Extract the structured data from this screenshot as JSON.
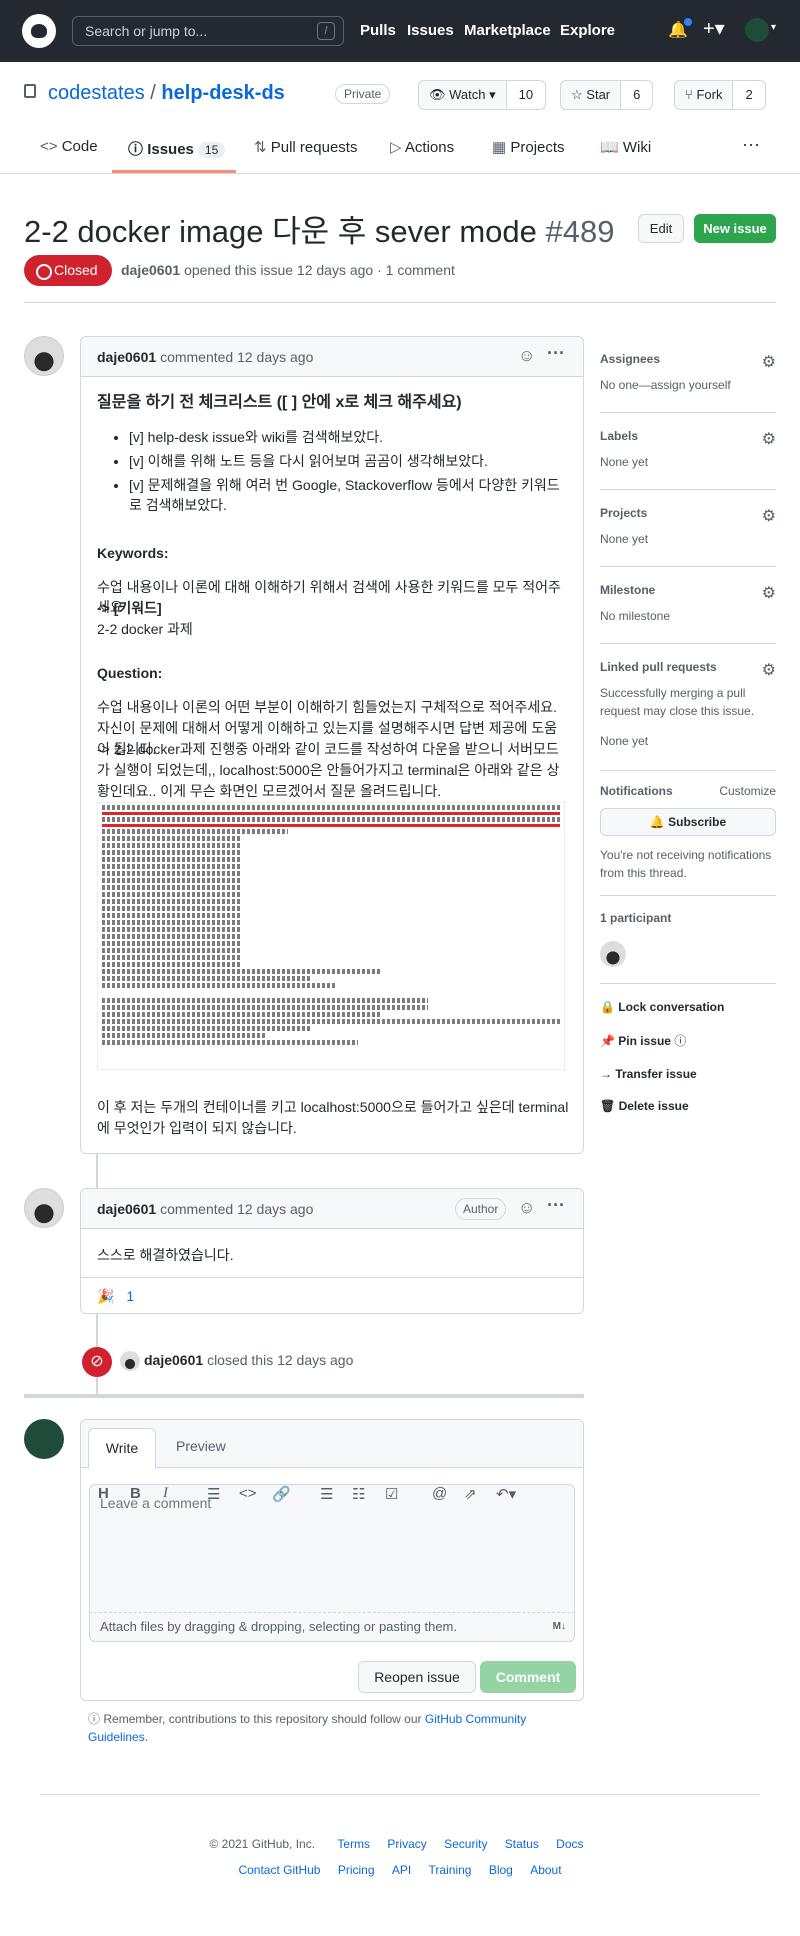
{
  "topbar": {
    "search_placeholder": "Search or jump to...",
    "slash": "/",
    "nav": [
      "Pulls",
      "Issues",
      "Marketplace",
      "Explore"
    ]
  },
  "repo": {
    "owner": "codestates",
    "sep": "/",
    "name": "help-desk-ds",
    "visibility": "Private",
    "watch_label": "Watch",
    "watch_count": "10",
    "star_label": "Star",
    "star_count": "6",
    "fork_label": "Fork",
    "fork_count": "2"
  },
  "tabs": {
    "code": "Code",
    "issues": "Issues",
    "issues_count": "15",
    "pulls": "Pull requests",
    "actions": "Actions",
    "projects": "Projects",
    "wiki": "Wiki"
  },
  "issue": {
    "title": "2-2 docker image 다운 후 sever mode",
    "number": "#489",
    "edit": "Edit",
    "new_issue": "New issue",
    "state": "Closed",
    "author": "daje0601",
    "meta_rest": "opened this issue 12 days ago · 1 comment"
  },
  "comment1": {
    "author": "daje0601",
    "action": "commented 12 days ago",
    "heading": "질문을 하기 전 체크리스트 ([ ] 안에 x로 체크 해주세요)",
    "checks": [
      "[v] help-desk issue와 wiki를 검색해보았다.",
      "[v] 이해를 위해 노트 등을 다시 읽어보며 곰곰이 생각해보았다.",
      "[v] 문제해결을 위해 여러 번 Google, Stackoverflow 등에서 다양한 키워드로 검색해보았다."
    ],
    "keywords_h": "Keywords:",
    "keywords_p1": "수업 내용이나 이론에 대해 이해하기 위해서 검색에 사용한 키워드를 모두 적어주세요",
    "keywords_p2": "-> [키워드]",
    "keywords_p3": "2-2 docker 과제",
    "question_h": "Question:",
    "question_p1": "수업 내용이나 이론의 어떤 부분이 이해하기 힘들었는지 구체적으로 적어주세요. 자신이 문제에 대해서 어떻게 이해하고 있는지를 설명해주시면 답변 제공에 도움이 됩니다.",
    "question_p2": "-> 2-2 docker과제 진행중 아래와 같이 코드를 작성하여 다운을 받으니 서버모드가 실행이 되었는데,, localhost:5000은 안들어가지고 terminal은 아래와 같은 상황인데요.. 이게 무슨 화면인 모르겠어서 질문 올려드립니다.",
    "closing": "이 후 저는 두개의 컨테이너를 키고 localhost:5000으로 들어가고 싶은데 terminal에 무엇인가 입력이 되지 않습니다."
  },
  "comment2": {
    "author": "daje0601",
    "action": "commented 12 days ago",
    "role": "Author",
    "body": "스스로 해결하였습니다.",
    "reaction_emoji": "🎉",
    "reaction_count": "1"
  },
  "event": {
    "actor": "daje0601",
    "text": "closed this 12 days ago"
  },
  "sidebar": {
    "assignees": "Assignees",
    "assignees_v": "No one—assign yourself",
    "labels": "Labels",
    "labels_v": "None yet",
    "projects": "Projects",
    "projects_v": "None yet",
    "milestone": "Milestone",
    "milestone_v": "No milestone",
    "linked": "Linked pull requests",
    "linked_v": "Successfully merging a pull request may close this issue.",
    "linked_v2": "None yet",
    "notifications": "Notifications",
    "customize": "Customize",
    "subscribe": "Subscribe",
    "notif_text": "You're not receiving notifications from this thread.",
    "participants": "1 participant",
    "lock": "Lock conversation",
    "pin": "Pin issue",
    "transfer": "Transfer issue",
    "delete": "Delete issue"
  },
  "composer": {
    "write": "Write",
    "preview": "Preview",
    "placeholder": "Leave a comment",
    "attach": "Attach files by dragging & dropping, selecting or pasting them.",
    "reopen": "Reopen issue",
    "comment": "Comment",
    "note_pre": "Remember, contributions to this repository should follow our",
    "note_link": "GitHub Community Guidelines",
    "note_post": "."
  },
  "footer": {
    "row1": [
      "© 2021 GitHub, Inc.",
      "Terms",
      "Privacy",
      "Security",
      "Status",
      "Docs"
    ],
    "row2": [
      "Contact GitHub",
      "Pricing",
      "API",
      "Training",
      "Blog",
      "About"
    ]
  },
  "colors": {
    "header": "#24292f",
    "closed": "#cf222e",
    "green": "#2da44e",
    "link": "#0969da",
    "tab_underline": "#fd8c73"
  }
}
